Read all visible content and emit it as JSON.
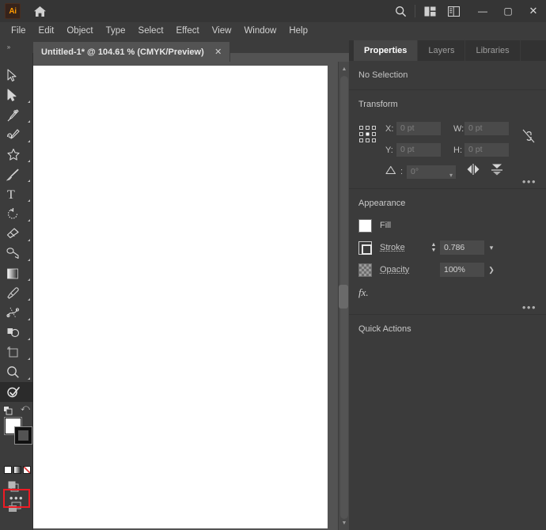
{
  "app": {
    "logo_text": "Ai",
    "home_icon": "home-icon",
    "search_icon": "search-icon",
    "arrange_documents_icon": "arrange-documents-icon",
    "workspace_switcher_icon": "workspace-switcher-icon",
    "minimize_label": "—",
    "maximize_label": "▢",
    "close_label": "✕"
  },
  "menubar": {
    "items": [
      {
        "label": "File"
      },
      {
        "label": "Edit"
      },
      {
        "label": "Object"
      },
      {
        "label": "Type"
      },
      {
        "label": "Select"
      },
      {
        "label": "Effect"
      },
      {
        "label": "View"
      },
      {
        "label": "Window"
      },
      {
        "label": "Help"
      }
    ]
  },
  "tabstrip": {
    "collapse_left": "»",
    "collapse_right": "»"
  },
  "document_tab": {
    "title": "Untitled-1* @ 104.61 % (CMYK/Preview)",
    "close_label": "✕"
  },
  "toolbar": {
    "tools": [
      {
        "name": "selection-tool"
      },
      {
        "name": "direct-selection-tool"
      },
      {
        "name": "pen-tool"
      },
      {
        "name": "curvature-tool"
      },
      {
        "name": "shape-tool"
      },
      {
        "name": "paintbrush-tool"
      },
      {
        "name": "type-tool"
      },
      {
        "name": "rotate-tool"
      },
      {
        "name": "eraser-tool"
      },
      {
        "name": "scissors-tool"
      },
      {
        "name": "artboard-tool"
      },
      {
        "name": "zoom-tool"
      },
      {
        "name": "shape-builder-tool"
      }
    ],
    "fill_color": "#ffffff",
    "stroke_color": "#000000",
    "swap_label": "⤺",
    "mini_swatches": [
      "color-swatch",
      "gradient-swatch",
      "none-swatch"
    ],
    "edit_toolbar_label": "•••",
    "highlight_color": "#ee1b24"
  },
  "canvas": {
    "artboard_color": "#ffffff",
    "background_color": "#535353"
  },
  "scrollbar": {
    "up_arrow": "▲",
    "down_arrow": "▼"
  },
  "panel": {
    "tabs": [
      {
        "label": "Properties",
        "active": true
      },
      {
        "label": "Layers",
        "active": false
      },
      {
        "label": "Libraries",
        "active": false
      }
    ],
    "selection_status": "No Selection",
    "transform": {
      "title": "Transform",
      "x_label": "X:",
      "x_value": "0 pt",
      "y_label": "Y:",
      "y_value": "0 pt",
      "w_label": "W:",
      "w_value": "0 pt",
      "h_label": "H:",
      "h_value": "0 pt",
      "angle_label": "angle-icon",
      "angle_value": "0°",
      "link_icon": "unlink-proportions-icon",
      "flip_horizontal_icon": "flip-horizontal-icon",
      "flip_vertical_icon": "flip-vertical-icon",
      "more_options": "•••"
    },
    "appearance": {
      "title": "Appearance",
      "fill_label": "Fill",
      "fill_color": "#ffffff",
      "stroke_label": "Stroke",
      "stroke_value": "0.786",
      "opacity_label": "Opacity",
      "opacity_value": "100%",
      "fx_label": "fx.",
      "more_options": "•••"
    },
    "quick_actions": {
      "title": "Quick Actions"
    }
  }
}
